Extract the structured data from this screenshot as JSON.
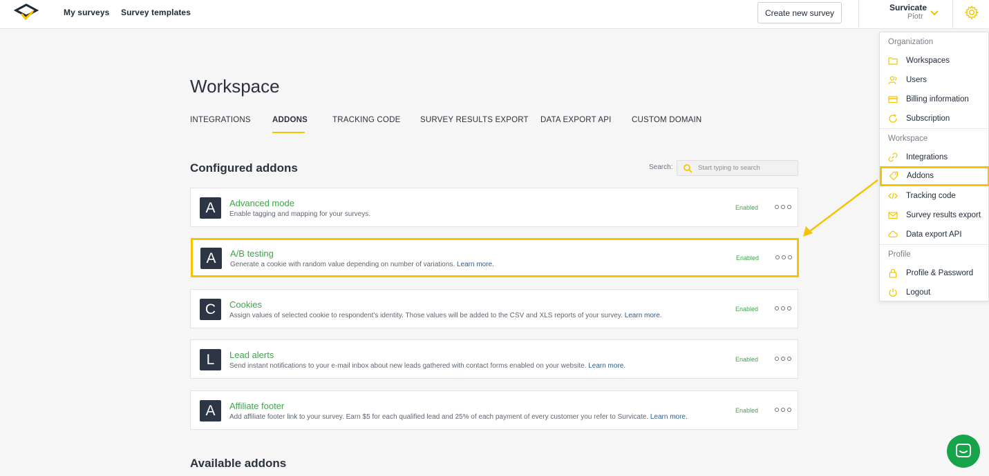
{
  "header": {
    "nav": [
      "My surveys",
      "Survey templates"
    ],
    "create_button": "Create new survey",
    "account_org": "Survicate",
    "account_user": "Piotr"
  },
  "page": {
    "title": "Workspace",
    "tabs": [
      "INTEGRATIONS",
      "ADDONS",
      "TRACKING CODE",
      "SURVEY RESULTS EXPORT",
      "DATA EXPORT API",
      "CUSTOM DOMAIN"
    ],
    "active_tab": "ADDONS"
  },
  "configured": {
    "title": "Configured addons",
    "search_label": "Search:",
    "search_placeholder": "Start typing to search",
    "items": [
      {
        "letter": "A",
        "name": "Advanced mode",
        "desc": "Enable tagging and mapping for your surveys.",
        "learn": "",
        "status": "Enabled"
      },
      {
        "letter": "A",
        "name": "A/B testing",
        "desc": "Generate a cookie with random value depending on number of variations.",
        "learn": "Learn more.",
        "status": "Enabled"
      },
      {
        "letter": "C",
        "name": "Cookies",
        "desc": "Assign values of selected cookie to respondent's identity. Those values will be added to the CSV and XLS reports of your survey.",
        "learn": "Learn more.",
        "status": "Enabled"
      },
      {
        "letter": "L",
        "name": "Lead alerts",
        "desc": "Send instant notifications to your e-mail inbox about new leads gathered with contact forms enabled on your website.",
        "learn": "Learn more.",
        "status": "Enabled"
      },
      {
        "letter": "A",
        "name": "Affiliate footer",
        "desc": "Add affiliate footer link to your survey. Earn $5 for each qualified lead and 25% of each payment of every customer you refer to Survicate.",
        "learn": "Learn more.",
        "status": "Enabled"
      }
    ]
  },
  "available": {
    "title": "Available addons"
  },
  "dropdown": {
    "organization_header": "Organization",
    "organization_items": [
      {
        "label": "Workspaces",
        "icon": "folder-icon"
      },
      {
        "label": "Users",
        "icon": "users-icon"
      },
      {
        "label": "Billing information",
        "icon": "credit-card-icon"
      },
      {
        "label": "Subscription",
        "icon": "refresh-icon"
      }
    ],
    "workspace_header": "Workspace",
    "workspace_items": [
      {
        "label": "Integrations",
        "icon": "link-icon"
      },
      {
        "label": "Addons",
        "icon": "tag-icon"
      },
      {
        "label": "Tracking code",
        "icon": "code-icon"
      },
      {
        "label": "Survey results export",
        "icon": "envelope-icon"
      },
      {
        "label": "Data export API",
        "icon": "cloud-icon"
      }
    ],
    "profile_header": "Profile",
    "profile_items": [
      {
        "label": "Profile & Password",
        "icon": "lock-icon"
      },
      {
        "label": "Logout",
        "icon": "power-icon"
      }
    ]
  },
  "colors": {
    "accent": "#f5c400",
    "enabled_green": "#3fa44a",
    "tile_dark": "#2c3644",
    "chat_green": "#17a34a"
  }
}
